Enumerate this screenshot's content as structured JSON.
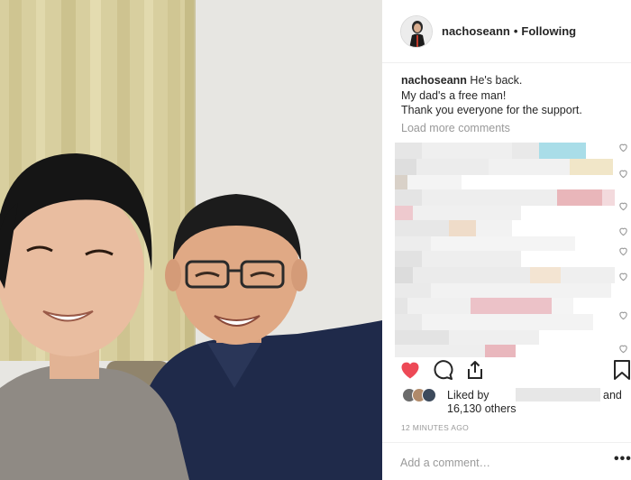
{
  "post": {
    "username": "nachoseann",
    "separator": "•",
    "follow_status": "Following",
    "caption_user": "nachoseann",
    "caption_lines": [
      "He's back.",
      "My dad's a free man!",
      "Thank you everyone for the support."
    ],
    "load_more": "Load more comments",
    "liked_by": "Liked by",
    "liked_and": "and",
    "liked_others": "16,130 others",
    "timestamp": "12 MINUTES AGO",
    "comment_placeholder": "Add a comment…",
    "more_options": "•••"
  },
  "icons": {
    "like": "heart-filled-icon",
    "comment": "speech-bubble-icon",
    "share": "share-icon",
    "save": "bookmark-icon"
  },
  "colors": {
    "like_red": "#ed4956",
    "text": "#262626",
    "muted": "#999999",
    "divider": "#efefef"
  }
}
